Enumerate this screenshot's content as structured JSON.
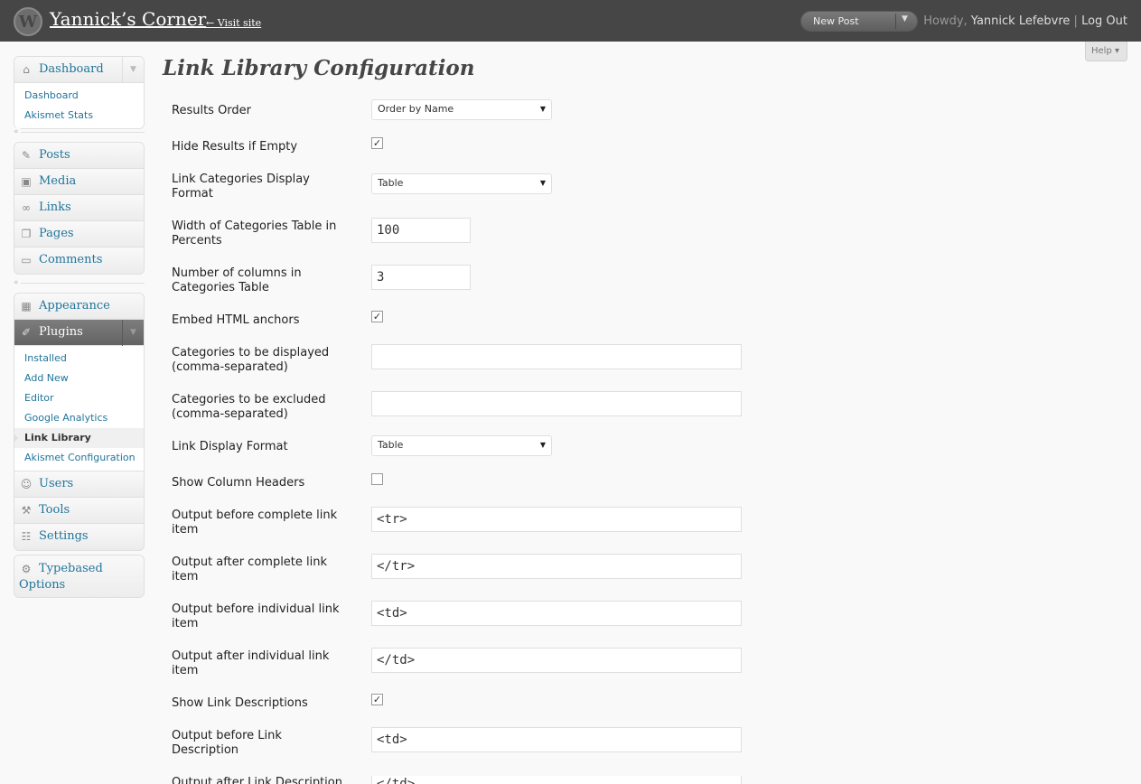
{
  "header": {
    "site_title": "Yannick’s Corner",
    "visit_site": "← Visit site",
    "new_post": "New Post",
    "howdy": "Howdy,",
    "user_name": "Yannick Lefebvre",
    "separator": "|",
    "logout": "Log Out",
    "help": "Help ▾"
  },
  "menu": {
    "dashboard": {
      "label": "Dashboard",
      "items": [
        "Dashboard",
        "Akismet Stats"
      ]
    },
    "posts": "Posts",
    "media": "Media",
    "links": "Links",
    "pages": "Pages",
    "comments": "Comments",
    "appearance": "Appearance",
    "plugins": {
      "label": "Plugins",
      "items": [
        "Installed",
        "Add New",
        "Editor",
        "Google Analytics",
        "Link Library",
        "Akismet Configuration"
      ]
    },
    "users": "Users",
    "tools": "Tools",
    "settings": "Settings",
    "typebased": "Typebased Options"
  },
  "page": {
    "title": "Link Library Configuration"
  },
  "form": {
    "results_order": {
      "label": "Results Order",
      "value": "Order by Name"
    },
    "hide_results": {
      "label": "Hide Results if Empty",
      "checked": "✓"
    },
    "cat_display_format": {
      "label": "Link Categories Display Format",
      "value": "Table"
    },
    "cat_table_width": {
      "label": "Width of Categories Table in Percents",
      "value": "100"
    },
    "cat_columns": {
      "label": "Number of columns in Categories Table",
      "value": "3"
    },
    "embed_anchors": {
      "label": "Embed HTML anchors",
      "checked": "✓"
    },
    "cats_displayed": {
      "label": "Categories to be displayed (comma-separated)",
      "value": ""
    },
    "cats_excluded": {
      "label": "Categories to be excluded (comma-separated)",
      "value": ""
    },
    "link_display_format": {
      "label": "Link Display Format",
      "value": "Table"
    },
    "show_col_headers": {
      "label": "Show Column Headers",
      "checked": ""
    },
    "before_item": {
      "label": "Output before complete link item",
      "value": "<tr>"
    },
    "after_item": {
      "label": "Output after complete link item",
      "value": "</tr>"
    },
    "before_link": {
      "label": "Output before individual link item",
      "value": "<td>"
    },
    "after_link": {
      "label": "Output after individual link item",
      "value": "</td>"
    },
    "show_descriptions": {
      "label": "Show Link Descriptions",
      "checked": "✓"
    },
    "before_desc": {
      "label": "Output before Link Description",
      "value": "<td>"
    },
    "after_desc": {
      "label": "Output after Link Description",
      "value": "</td>"
    }
  }
}
